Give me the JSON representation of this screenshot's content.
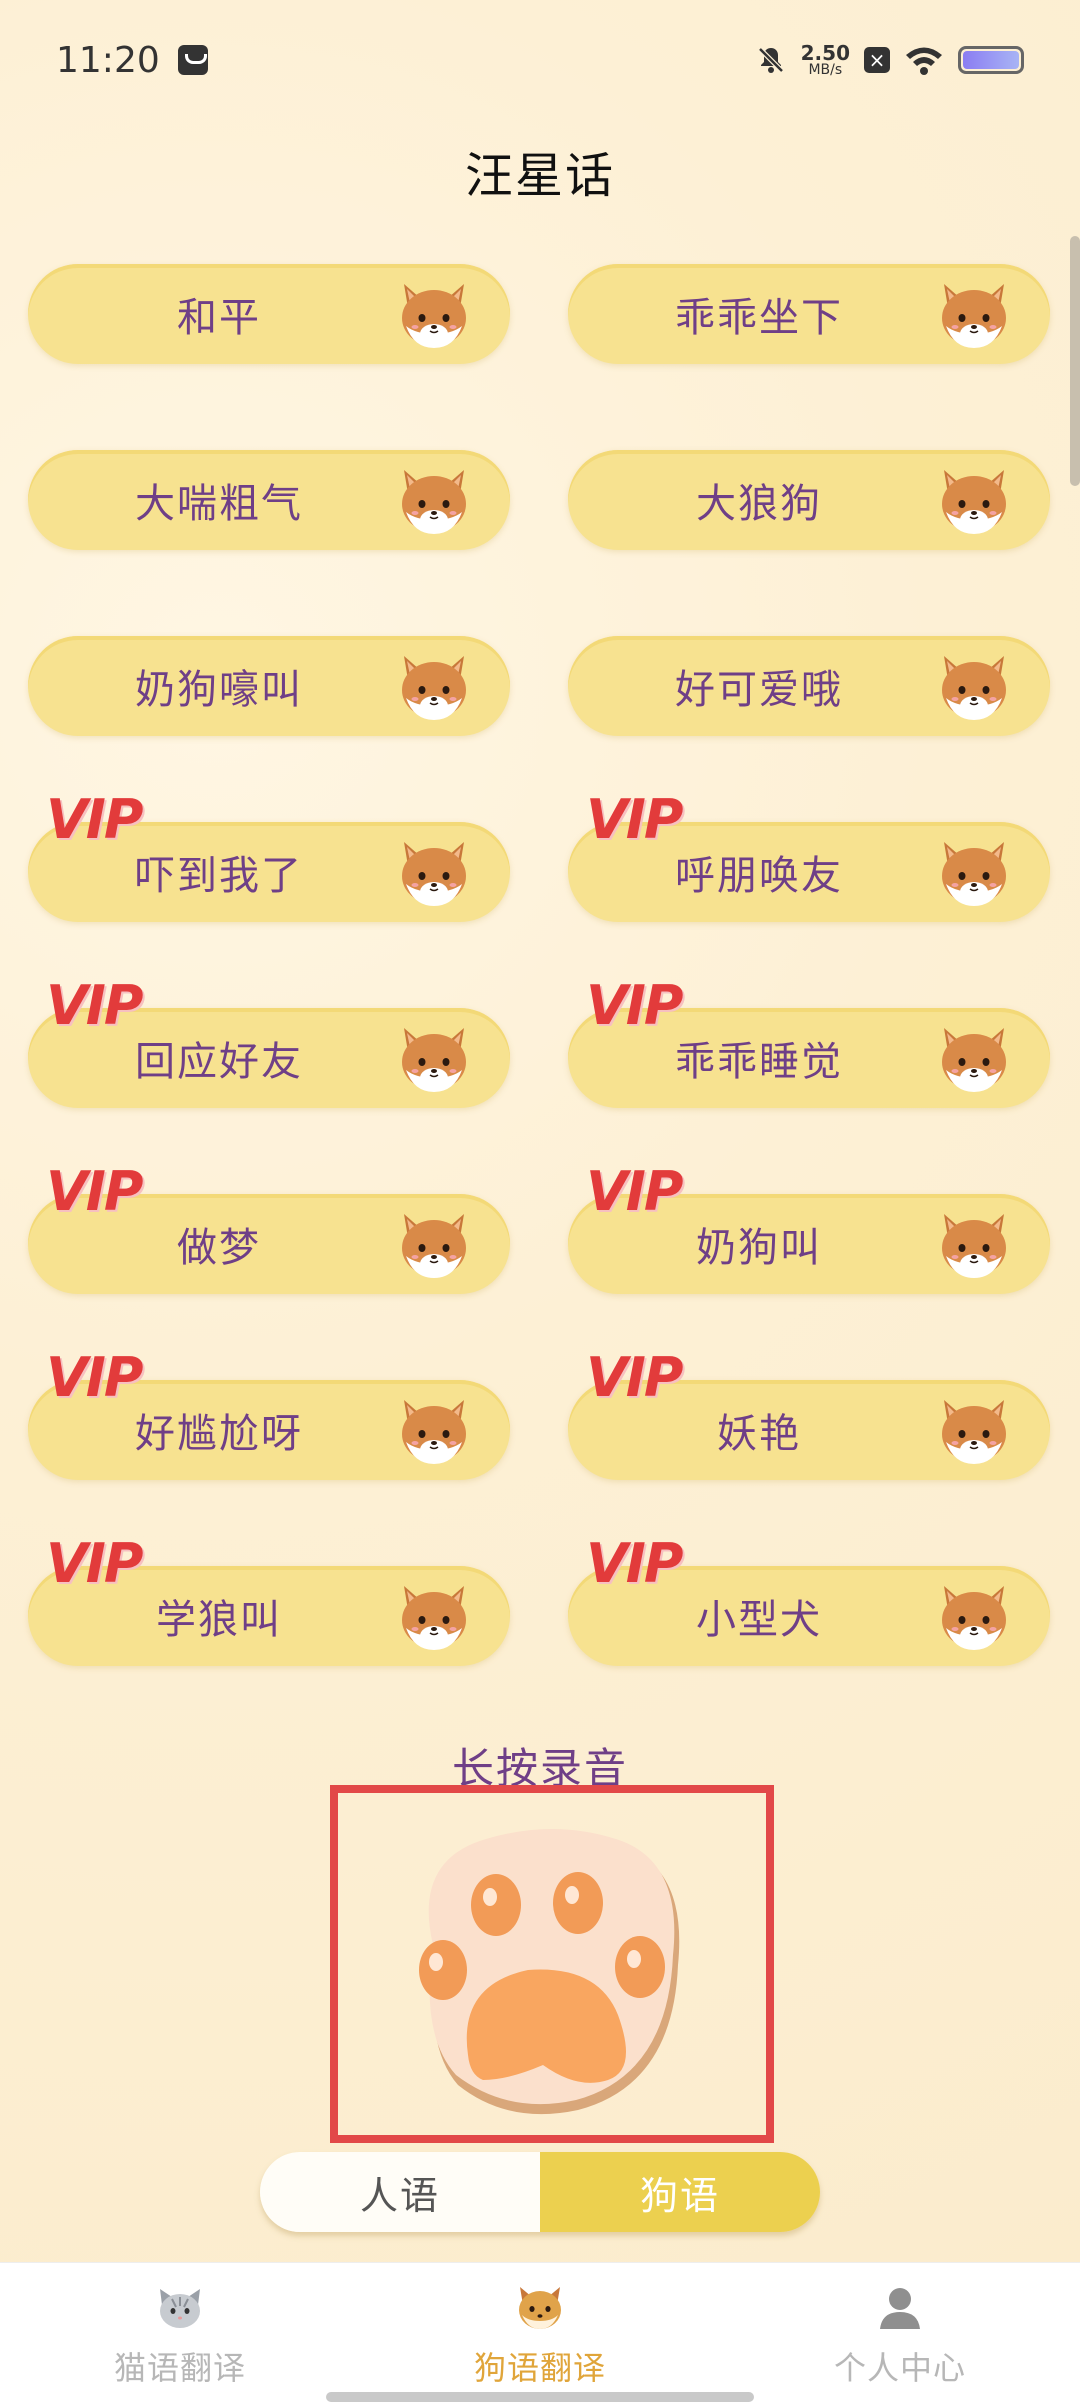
{
  "status_bar": {
    "time": "11:20",
    "net_speed_value": "2.50",
    "net_speed_unit": "MB/s"
  },
  "page": {
    "title": "汪星话"
  },
  "phrases": [
    {
      "label": "和平",
      "vip": false
    },
    {
      "label": "乖乖坐下",
      "vip": false
    },
    {
      "label": "大喘粗气",
      "vip": false
    },
    {
      "label": "大狼狗",
      "vip": false
    },
    {
      "label": "奶狗嚎叫",
      "vip": false
    },
    {
      "label": "好可爱哦",
      "vip": false
    },
    {
      "label": "吓到我了",
      "vip": true
    },
    {
      "label": "呼朋唤友",
      "vip": true
    },
    {
      "label": "回应好友",
      "vip": true
    },
    {
      "label": "乖乖睡觉",
      "vip": true
    },
    {
      "label": "做梦",
      "vip": true
    },
    {
      "label": "奶狗叫",
      "vip": true
    },
    {
      "label": "好尴尬呀",
      "vip": true
    },
    {
      "label": "妖艳",
      "vip": true
    },
    {
      "label": "学狼叫",
      "vip": true
    },
    {
      "label": "小型犬",
      "vip": true
    }
  ],
  "vip_text": "VIP",
  "record": {
    "hint": "长按录音"
  },
  "toggle": {
    "human_label": "人语",
    "dog_label": "狗语",
    "selected": "dog"
  },
  "bottom_nav": {
    "items": [
      {
        "label": "猫语翻译",
        "icon": "cat-icon",
        "active": false
      },
      {
        "label": "狗语翻译",
        "icon": "dog-icon",
        "active": true
      },
      {
        "label": "个人中心",
        "icon": "person-icon",
        "active": false
      }
    ]
  },
  "colors": {
    "pill_bg": "#f7e290",
    "label_purple": "#6f3f87",
    "vip_red": "#e23b3b",
    "toggle_active": "#ecd04f",
    "nav_active": "#e0a53a"
  }
}
